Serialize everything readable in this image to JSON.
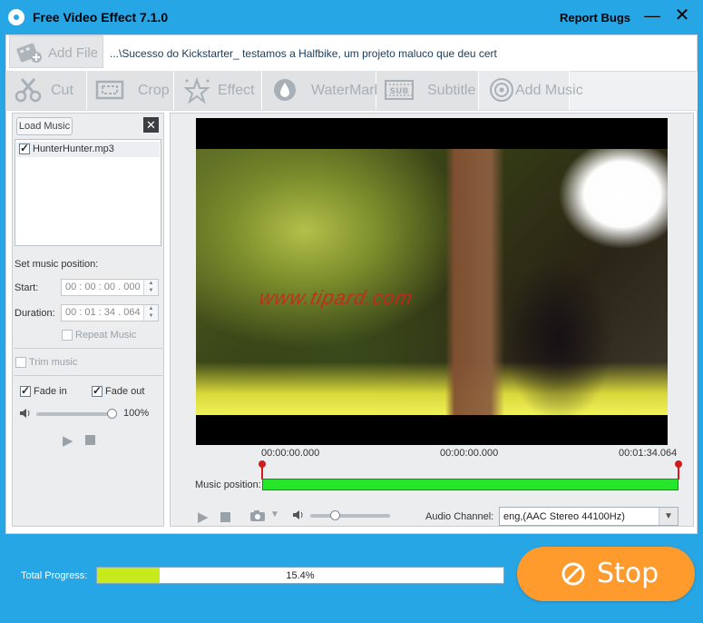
{
  "window": {
    "title": "Free Video Effect 7.1.0",
    "report_bugs": "Report Bugs",
    "minimize": "—",
    "close": "✕"
  },
  "file": {
    "add_label": "Add File",
    "path": "...\\Sucesso do Kickstarter_ testamos a Halfbike, um projeto maluco que deu cert"
  },
  "toolbar": {
    "tabs": [
      "Cut",
      "Crop",
      "Effect",
      "WaterMark",
      "Subtitle",
      "Add Music"
    ]
  },
  "music": {
    "load_label": "Load Music",
    "remove_icon": "✕",
    "items": [
      {
        "name": "HunterHunter.mp3",
        "checked": true
      }
    ],
    "set_position_label": "Set music position:",
    "start_label": "Start:",
    "start_value": "00 : 00 : 00 . 000",
    "duration_label": "Duration:",
    "duration_value": "00 : 01 : 34 . 064",
    "repeat_label": "Repeat Music",
    "trim_label": "Trim music",
    "fade_in_label": "Fade in",
    "fade_out_label": "Fade out",
    "volume_percent": "100%",
    "volume_level": 1.0
  },
  "preview": {
    "watermark_text": "www.tipard.com",
    "time_start": "00:00:00.000",
    "time_current": "00:00:00.000",
    "time_end": "00:01:34.064",
    "music_position_label": "Music position:",
    "audio_channel_label": "Audio Channel:",
    "audio_channel_value": "eng,(AAC Stereo 44100Hz)",
    "volume_level": 0.28
  },
  "progress": {
    "label": "Total Progress:",
    "percent_text": "15.4%",
    "fraction": 0.154
  },
  "stop": {
    "label": "Stop"
  },
  "colors": {
    "brand": "#27a6e6",
    "stop_button": "#ff9a2c",
    "progress_fill": "#c7ea1d",
    "music_bar": "#27e52a",
    "pin": "#d11c1c"
  }
}
